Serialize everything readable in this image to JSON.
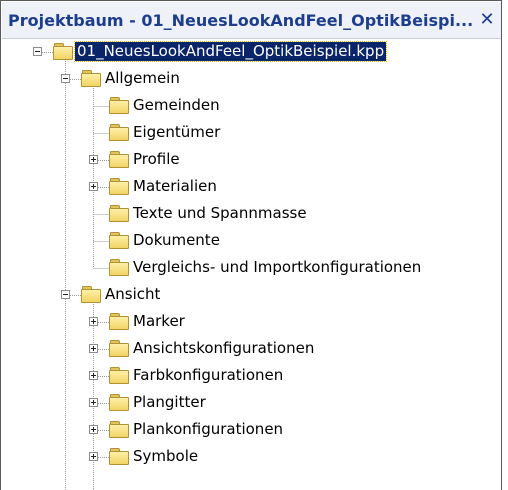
{
  "panel": {
    "title": "Projektbaum - 01_NeuesLookAndFeel_OptikBeispi...",
    "close_label": "✕"
  },
  "tree": {
    "root": {
      "label": "01_NeuesLookAndFeel_OptikBeispiel.kpp",
      "expanded": true,
      "selected": true
    },
    "sections": [
      {
        "label": "Allgemein",
        "expanded": true,
        "children": [
          {
            "label": "Gemeinden",
            "expandable": false
          },
          {
            "label": "Eigentümer",
            "expandable": false
          },
          {
            "label": "Profile",
            "expandable": true
          },
          {
            "label": "Materialien",
            "expandable": true
          },
          {
            "label": "Texte und Spannmasse",
            "expandable": false
          },
          {
            "label": "Dokumente",
            "expandable": false
          },
          {
            "label": "Vergleichs- und Importkonfigurationen",
            "expandable": false
          }
        ]
      },
      {
        "label": "Ansicht",
        "expanded": true,
        "children": [
          {
            "label": "Marker",
            "expandable": true
          },
          {
            "label": "Ansichtskonfigurationen",
            "expandable": true
          },
          {
            "label": "Farbkonfigurationen",
            "expandable": true
          },
          {
            "label": "Plangitter",
            "expandable": true
          },
          {
            "label": "Plankonfigurationen",
            "expandable": true
          },
          {
            "label": "Symbole",
            "expandable": true
          }
        ]
      }
    ]
  },
  "colors": {
    "title_text": "#1d3d8f",
    "selection": "#0a246a",
    "folder": "#f2d466"
  }
}
